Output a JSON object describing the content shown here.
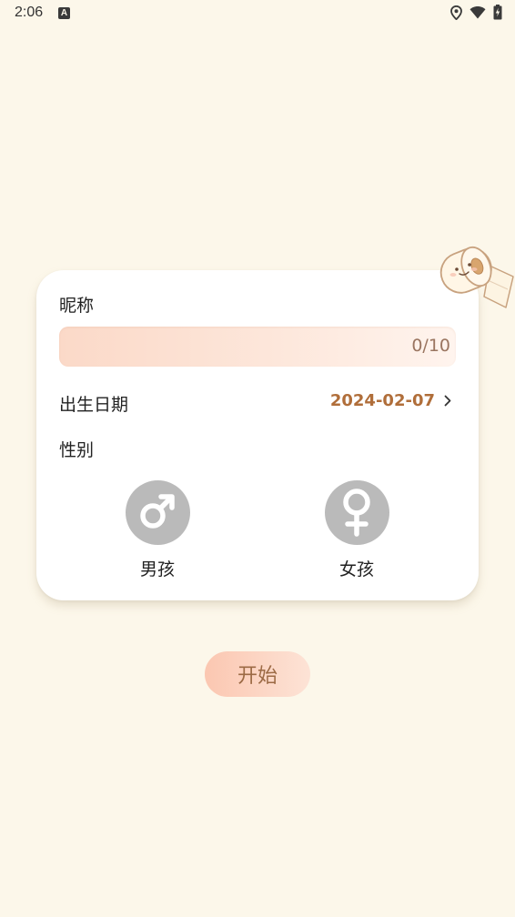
{
  "status_bar": {
    "time": "2:06",
    "a_icon": "A"
  },
  "form": {
    "nickname_label": "昵称",
    "nickname_counter": "0/10",
    "birth_label": "出生日期",
    "birth_value": "2024-02-07",
    "gender_label": "性别",
    "gender_male_label": "男孩",
    "gender_female_label": "女孩"
  },
  "start_button_label": "开始",
  "icons": {
    "status": [
      "location-icon",
      "wifi-icon",
      "battery-charging-icon"
    ],
    "chevron": "chevron-right-icon",
    "male": "male-symbol-icon",
    "female": "female-symbol-icon",
    "mascot": "toilet-paper-mascot-icon"
  },
  "colors": {
    "background": "#fcf7ea",
    "accent": "#b06e3a",
    "gender_unselected": "#bababa",
    "button_gradient_start": "#fbc7b1",
    "button_gradient_end": "#fde3d6"
  }
}
